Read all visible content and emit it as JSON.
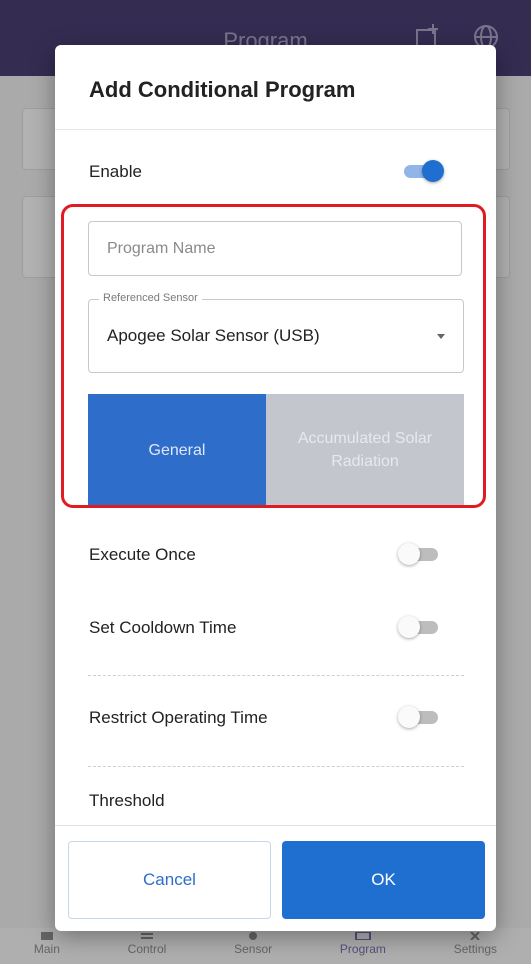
{
  "app": {
    "title": "Program",
    "nav": [
      {
        "label": "Main",
        "icon": "home-icon",
        "active": false
      },
      {
        "label": "Control",
        "icon": "control-icon",
        "active": false
      },
      {
        "label": "Sensor",
        "icon": "sensor-icon",
        "active": false
      },
      {
        "label": "Program",
        "icon": "program-icon",
        "active": true
      },
      {
        "label": "Settings",
        "icon": "settings-icon",
        "active": false
      }
    ]
  },
  "dialog": {
    "title": "Add Conditional Program",
    "enable": {
      "label": "Enable",
      "checked": true
    },
    "program_name": {
      "value": "",
      "placeholder": "Program Name"
    },
    "referenced_sensor": {
      "legend": "Referenced Sensor",
      "value": "Apogee Solar Sensor (USB)"
    },
    "tabs": [
      {
        "label": "General",
        "active": true
      },
      {
        "label": "Accumulated Solar Radiation",
        "active": false
      }
    ],
    "execute_once": {
      "label": "Execute Once",
      "checked": false
    },
    "cooldown": {
      "label": "Set Cooldown Time",
      "checked": false
    },
    "restrict_time": {
      "label": "Restrict Operating Time",
      "checked": false
    },
    "threshold": {
      "label": "Threshold"
    },
    "cancel_label": "Cancel",
    "ok_label": "OK"
  },
  "colors": {
    "accent": "#1f6fd1",
    "header": "#4a3e72",
    "highlight": "#e11b22"
  }
}
